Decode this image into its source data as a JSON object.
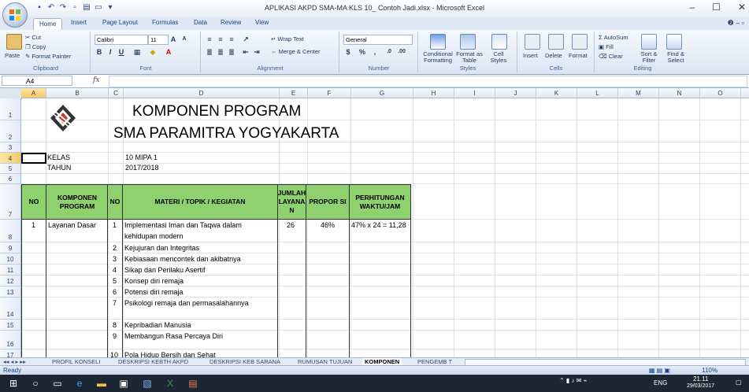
{
  "window": {
    "title": "APLIKASI AKPD SMA-MA  KLS 10_ Contoh Jadi.xlsx - Microsoft Excel",
    "controls": [
      "–",
      "☐",
      "✕"
    ]
  },
  "ribbon_tabs": [
    "Home",
    "Insert",
    "Page Layout",
    "Formulas",
    "Data",
    "Review",
    "View"
  ],
  "ribbon": {
    "clipboard": {
      "paste": "Paste",
      "cut": "Cut",
      "copy": "Copy",
      "format_painter": "Format Painter",
      "label": "Clipboard"
    },
    "font": {
      "name": "Calibri",
      "size": "11",
      "label": "Font"
    },
    "alignment": {
      "wrap": "Wrap Text",
      "merge": "Merge & Center",
      "label": "Alignment"
    },
    "number": {
      "format": "General",
      "label": "Number"
    },
    "styles": {
      "conditional": "Conditional Formatting",
      "table": "Format as Table",
      "cell": "Cell Styles",
      "label": "Styles"
    },
    "cells": {
      "insert": "Insert",
      "delete": "Delete",
      "format": "Format",
      "label": "Cells"
    },
    "editing": {
      "autosum": "AutoSum",
      "fill": "Fill",
      "clear": "Clear",
      "sort": "Sort & Filter",
      "find": "Find & Select",
      "label": "Editing"
    }
  },
  "formula_bar": {
    "name_box": "A4",
    "fx": "fx",
    "content": ""
  },
  "columns": [
    "A",
    "B",
    "C",
    "D",
    "E",
    "F",
    "G",
    "H",
    "I",
    "J",
    "K",
    "L",
    "M",
    "N",
    "O",
    "P"
  ],
  "rows": [
    "1",
    "2",
    "3",
    "4",
    "5",
    "6",
    "7",
    "8",
    "9",
    "10",
    "11",
    "12",
    "13",
    "14",
    "15",
    "16",
    "17"
  ],
  "sheet": {
    "title1": "KOMPONEN PROGRAM",
    "title2": "SMA PARAMITRA YOGYAKARTA",
    "kelas_label": "KELAS",
    "kelas_value": "10 MIPA 1",
    "tahun_label": "TAHUN",
    "tahun_value": "2017/2018",
    "headers": {
      "no": "NO",
      "komponen": "KOMPONEN PROGRAM",
      "no2": "NO",
      "materi": "MATERI / TOPIK / KEGIATAN",
      "jumlah": "JUMLAH LAYANA N",
      "proporsi": "PROPOR SI",
      "perhitungan": "PERHITUNGAN WAKTU/JAM"
    },
    "first_row": {
      "no": "1",
      "komponen": "Layanan Dasar",
      "jumlah": "26",
      "proporsi": "46%",
      "perhitungan": "47%  x 24 = 11,28"
    },
    "items": [
      {
        "no": "1",
        "text": "Implementasi Iman dan Taqwa dalam",
        "text2": "kehidupan modern"
      },
      {
        "no": "2",
        "text": "Kejujuran dan Integritas"
      },
      {
        "no": "3",
        "text": "Kebiasaan mencontek dan akibatnya"
      },
      {
        "no": "4",
        "text": "Sikap dan Perilaku Asertif"
      },
      {
        "no": "5",
        "text": "Konsep diri remaja"
      },
      {
        "no": "6",
        "text": "Potensi diri remaja"
      },
      {
        "no": "7",
        "text": "Psikologi remaja dan permasalahannya"
      },
      {
        "no": "8",
        "text": "Kepribadian Manusia"
      },
      {
        "no": "9",
        "text": "Membangun Rasa Percaya Diri"
      },
      {
        "no": "10",
        "text": "Pola Hidup Bersih dan Sehat"
      }
    ]
  },
  "sheet_tabs": [
    "PROFIL KONSELI",
    "DESKRIPSI KEBTH AKPD",
    "DESKRIPSI KEB SARANA",
    "RUMUSAN TUJUAN",
    "KOMPONEN",
    "PENGEMB T"
  ],
  "status": {
    "ready": "Ready",
    "zoom": "110%"
  },
  "taskbar": {
    "lang": "ENG",
    "time": "21.11",
    "date": "29/03/2017"
  }
}
